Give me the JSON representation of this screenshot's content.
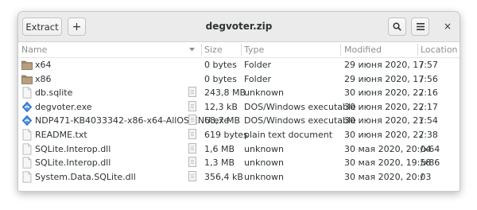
{
  "window": {
    "title": "degvoter.zip"
  },
  "header": {
    "extract_label": "Extract",
    "add_label": "+",
    "search_label": "🔍",
    "menu_label": "≡",
    "close_label": "×"
  },
  "columns": {
    "name": "Name",
    "size": "Size",
    "type": "Type",
    "modified": "Modified",
    "location": "Location"
  },
  "files": [
    {
      "icon": "folder-icon",
      "name": "x64",
      "size": "0 bytes",
      "type": "Folder",
      "modified": "29 июня 2020, 17:57",
      "location": "/"
    },
    {
      "icon": "folder-icon",
      "name": "x86",
      "size": "0 bytes",
      "type": "Folder",
      "modified": "29 июня 2020, 17:56",
      "location": "/"
    },
    {
      "icon": "document-icon",
      "name": "db.sqlite",
      "size": "243,8 MB",
      "type": "unknown",
      "modified": "30 июня 2020, 22:16",
      "location": "/"
    },
    {
      "icon": "exe-icon",
      "name": "degvoter.exe",
      "size": "12,3 kB",
      "type": "DOS/Windows executable",
      "modified": "30 июня 2020, 22:17",
      "location": "/"
    },
    {
      "icon": "exe-icon",
      "name": "NDP471-KB4033342-x86-x64-AllOS-ENU.exe",
      "size": "68,7 MB",
      "type": "DOS/Windows executable",
      "modified": "30 июня 2020, 21:54",
      "location": "/"
    },
    {
      "icon": "document-icon",
      "name": "README.txt",
      "size": "619 bytes",
      "type": "plain text document",
      "modified": "30 июня 2020, 22:38",
      "location": "/"
    },
    {
      "icon": "document-icon",
      "name": "SQLite.Interop.dll",
      "size": "1,6 MB",
      "type": "unknown",
      "modified": "30 мая 2020, 20:04",
      "location": "/x64"
    },
    {
      "icon": "document-icon",
      "name": "SQLite.Interop.dll",
      "size": "1,3 MB",
      "type": "unknown",
      "modified": "30 мая 2020, 19:58",
      "location": "/x86"
    },
    {
      "icon": "document-icon",
      "name": "System.Data.SQLite.dll",
      "size": "356,4 kB",
      "type": "unknown",
      "modified": "30 мая 2020, 20:03",
      "location": "/"
    }
  ],
  "colors": {
    "folder": "#a08868",
    "exe": "#2a6fc9",
    "headerbar": "#ebebeb"
  }
}
